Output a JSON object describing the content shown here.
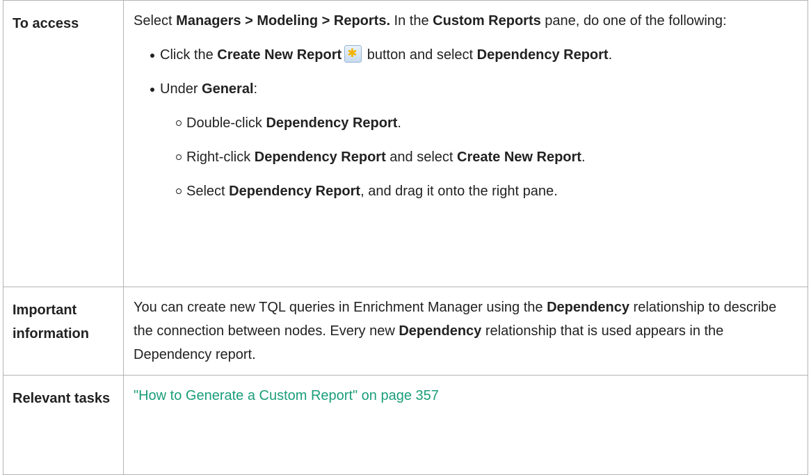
{
  "rows": [
    {
      "label": "To access",
      "intro": {
        "t1": "Select ",
        "b1": "Managers > Modeling > Reports.",
        "t2": " In the ",
        "b2": "Custom Reports",
        "t3": " pane, do one of the following:"
      },
      "bullet1": {
        "t1": "Click the ",
        "b1": "Create New Report",
        "icon": "create-new-report-icon",
        "t2": " button and select ",
        "b2": "Dependency Report",
        "t3": "."
      },
      "bullet2": {
        "t1": "Under ",
        "b1": "General",
        "t2": ":"
      },
      "sub1": {
        "t1": "Double-click ",
        "b1": "Dependency Report",
        "t2": "."
      },
      "sub2": {
        "t1": "Right-click ",
        "b1": "Dependency Report",
        "t2": " and select ",
        "b2": "Create New Report",
        "t3": "."
      },
      "sub3": {
        "t1": "Select ",
        "b1": "Dependency Report",
        "t2": ", and drag it onto the right pane."
      }
    },
    {
      "label": "Important information",
      "text": {
        "t1": "You can create new TQL queries in Enrichment Manager using the ",
        "b1": "Dependency",
        "t2": " relationship to describe the connection between nodes. Every new ",
        "b2": "Dependency",
        "t3": " relationship that is used appears in the Dependency report."
      }
    },
    {
      "label": "Relevant tasks",
      "link": "\"How to Generate a Custom Report\" on page 357"
    }
  ],
  "colors": {
    "link": "#1a9e78",
    "border": "#b3b3b3",
    "text": "#222222"
  }
}
